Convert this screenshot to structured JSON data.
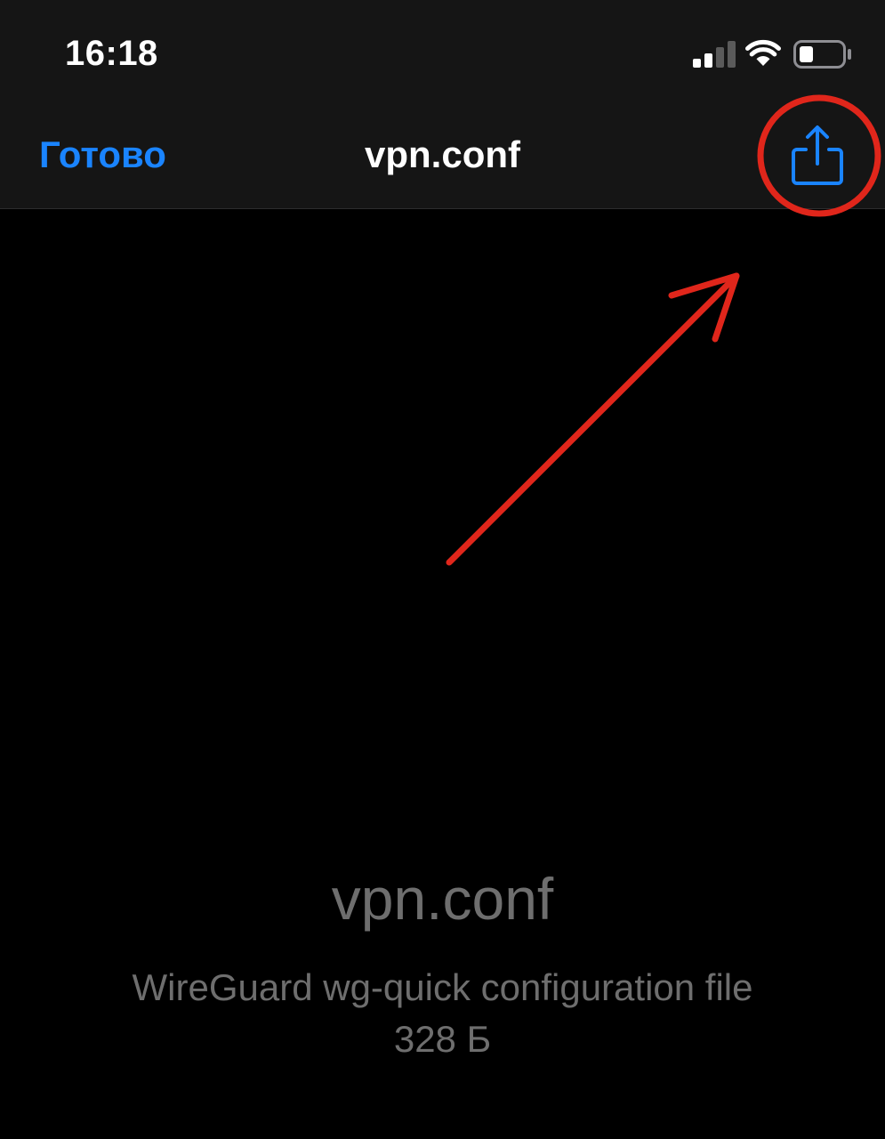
{
  "status_bar": {
    "time": "16:18",
    "signal_bars_active": 2,
    "signal_bars_total": 4,
    "battery_level": 0.3
  },
  "nav_bar": {
    "done_label": "Готово",
    "title": "vpn.conf",
    "share_icon": "share-icon"
  },
  "preview": {
    "file_name": "vpn.conf",
    "file_type": "WireGuard wg-quick configuration file",
    "file_size": "328 Б"
  },
  "annotation": {
    "color": "#e0261b",
    "shapes": [
      "circle",
      "arrow"
    ]
  },
  "colors": {
    "background": "#000000",
    "nav_background": "#151515",
    "accent": "#1a84ff",
    "secondary_text": "#6e6e6e"
  }
}
